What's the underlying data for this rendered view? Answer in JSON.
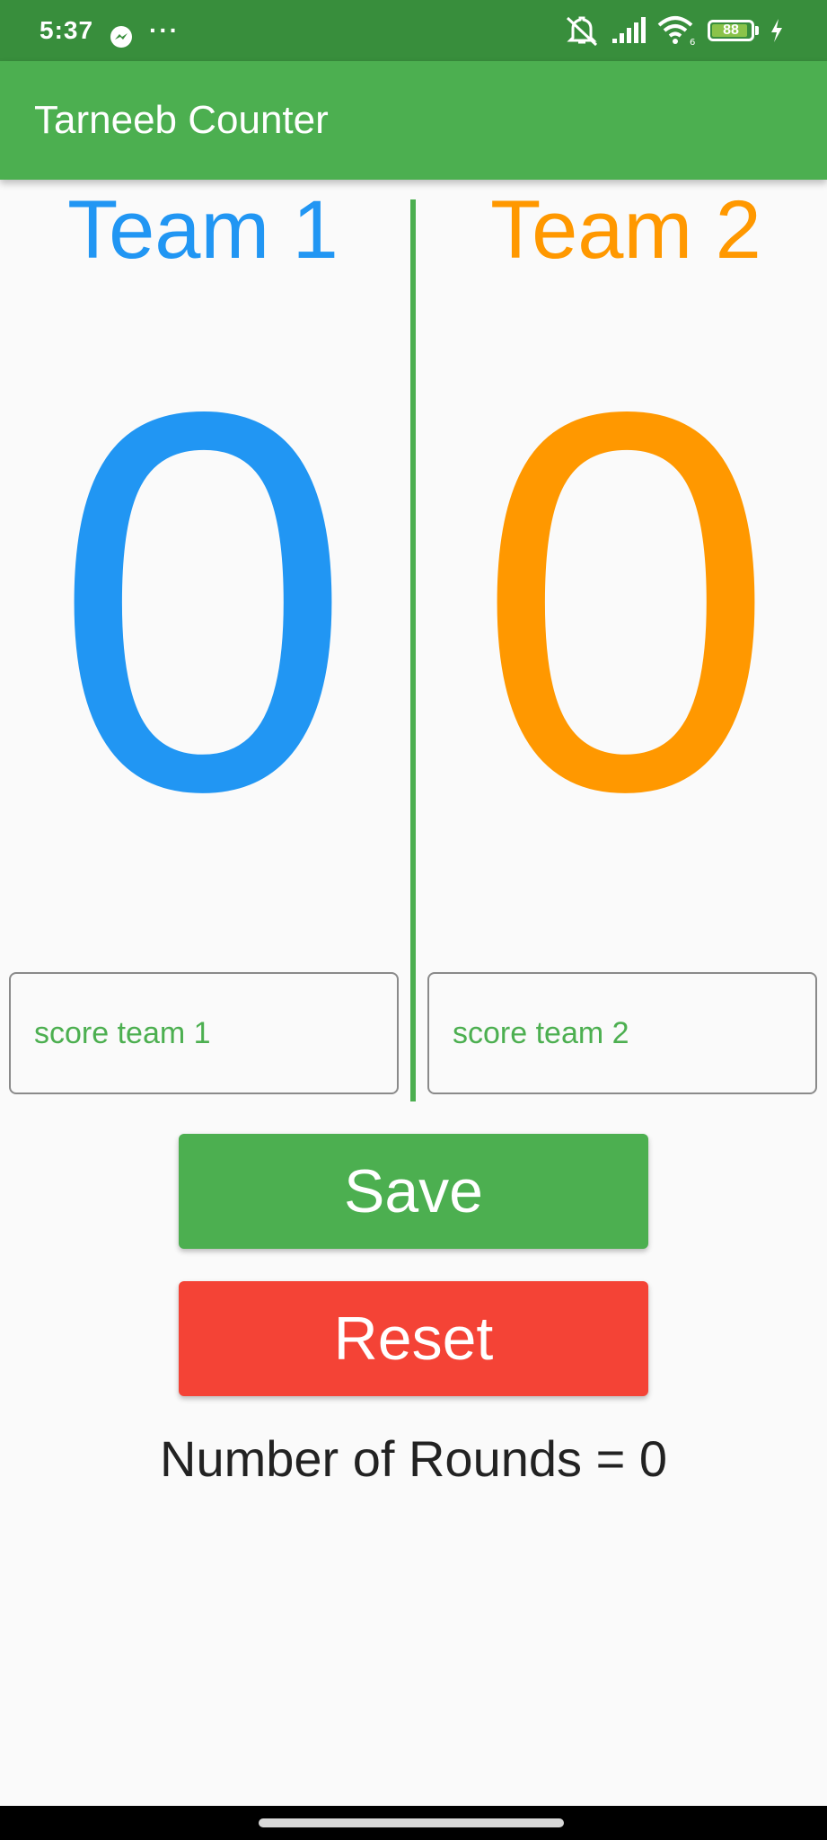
{
  "status_bar": {
    "time": "5:37",
    "battery": "88",
    "battery_level_percent": 88,
    "icons": [
      "messenger-icon",
      "more-dots-icon",
      "mute-icon",
      "signal-icon",
      "wifi-icon",
      "battery-icon",
      "charging-icon"
    ]
  },
  "app_bar": {
    "title": "Tarneeb Counter"
  },
  "teams": [
    {
      "name": "Team 1",
      "score": "0",
      "input_placeholder": "score team 1",
      "color": "#2196f3"
    },
    {
      "name": "Team 2",
      "score": "0",
      "input_placeholder": "score team 2",
      "color": "#ff9800"
    }
  ],
  "actions": {
    "save_label": "Save",
    "reset_label": "Reset"
  },
  "rounds_text": "Number of Rounds = 0",
  "colors": {
    "primary": "#4caf50",
    "primary_dark": "#388e3c",
    "reset": "#f44336"
  }
}
